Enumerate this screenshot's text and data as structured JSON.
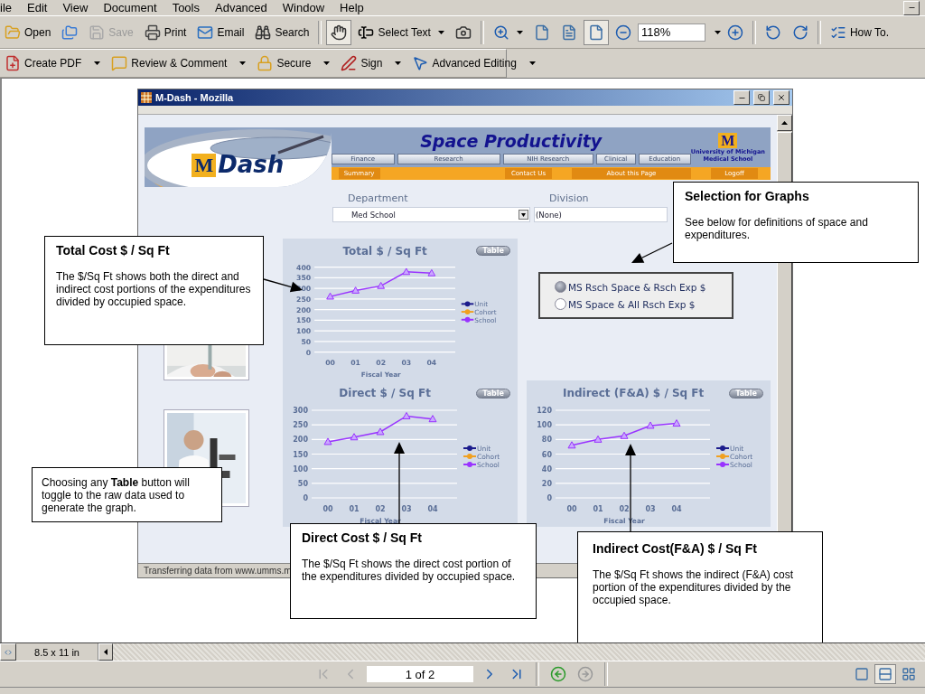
{
  "menu_bar": [
    "ile",
    "Edit",
    "View",
    "Document",
    "Tools",
    "Advanced",
    "Window",
    "Help"
  ],
  "toolbar_1": [
    {
      "kind": "button",
      "label": "Open",
      "selected": false,
      "disabled": false,
      "menu": false
    },
    {
      "kind": "button",
      "selected": false,
      "disabled": false,
      "menu": false
    },
    {
      "kind": "button",
      "label": "Save",
      "selected": false,
      "disabled": true,
      "menu": false
    },
    {
      "kind": "button",
      "label": "Print",
      "selected": false,
      "disabled": false,
      "menu": false
    },
    {
      "kind": "button",
      "label": "Email",
      "selected": false,
      "disabled": false,
      "menu": false
    },
    {
      "kind": "button",
      "label": "Search",
      "selected": false,
      "disabled": false,
      "menu": false
    },
    {
      "kind": "separator"
    },
    {
      "kind": "button",
      "selected": true,
      "disabled": false,
      "menu": false
    },
    {
      "kind": "button",
      "label": "Select Text",
      "selected": false,
      "disabled": false,
      "menu": true
    },
    {
      "kind": "button",
      "selected": false,
      "disabled": false,
      "menu": false
    },
    {
      "kind": "separator"
    },
    {
      "kind": "button",
      "selected": false,
      "disabled": false,
      "menu": true
    },
    {
      "kind": "button",
      "selected": false,
      "disabled": false,
      "menu": false
    },
    {
      "kind": "button",
      "selected": false,
      "disabled": false,
      "menu": false
    },
    {
      "kind": "button",
      "selected": true,
      "disabled": false,
      "menu": false
    },
    {
      "kind": "button",
      "selected": false,
      "disabled": false,
      "menu": false
    },
    {
      "kind": "field",
      "value": "118%"
    },
    {
      "kind": "button",
      "selected": false,
      "disabled": false,
      "menu": false
    },
    {
      "kind": "separator"
    },
    {
      "kind": "button",
      "selected": false,
      "disabled": false,
      "menu": false
    },
    {
      "kind": "button",
      "selected": false,
      "disabled": false,
      "menu": false
    },
    {
      "kind": "separator"
    },
    {
      "kind": "button",
      "label": "How To.",
      "selected": false,
      "disabled": false,
      "menu": false
    }
  ],
  "toolbar_2": [
    {
      "label": "Create PDF"
    },
    {
      "label": "Review & Comment"
    },
    {
      "label": "Secure"
    },
    {
      "label": "Sign"
    },
    {
      "label": "Advanced Editing"
    }
  ],
  "browser": {
    "title": "M-Dash - Mozilla",
    "status": "Transferring data from www.umms.m"
  },
  "mdash": {
    "logo_letter": "M",
    "logo_word": "Dash",
    "heading": "Space Productivity",
    "nav": [
      "Finance",
      "Research",
      "NIH Research",
      "Clinical",
      "Education"
    ],
    "institution_mark": "M",
    "institution": [
      "University of Michigan",
      "Medical School"
    ],
    "links_left": [
      "Summary"
    ],
    "links_right": [
      "Contact Us",
      "About this Page",
      "Logoff"
    ],
    "department": {
      "label": "Department",
      "value": "Med School"
    },
    "division": {
      "label": "Division",
      "value": "(None)"
    },
    "radios": [
      {
        "label": "MS Rsch Space & Rsch Exp $",
        "selected": true
      },
      {
        "label": "MS Space & All Rsch Exp $",
        "selected": false
      }
    ],
    "charts": [
      {
        "title": "Total $ / Sq Ft",
        "table_button": "Table",
        "chart_data": {
          "type": "line",
          "grid": true,
          "xlabel": "Fiscal Year",
          "categories": [
            "00",
            "01",
            "02",
            "03",
            "04"
          ],
          "ylim": [
            0,
            400
          ],
          "yticks": [
            0,
            50,
            100,
            150,
            200,
            250,
            300,
            350,
            400
          ],
          "series": [
            {
              "name": "Unit",
              "color": "#1c1c8c",
              "values": [
                null,
                null,
                null,
                null,
                null
              ]
            },
            {
              "name": "Cohort",
              "color": "#f0a020",
              "values": [
                null,
                null,
                null,
                null,
                null
              ]
            },
            {
              "name": "School",
              "color": "#9933ff",
              "marker": "triangle",
              "values": [
                262,
                290,
                312,
                378,
                372
              ]
            }
          ]
        }
      },
      {
        "title": "Direct $ / Sq Ft",
        "table_button": "Table",
        "chart_data": {
          "type": "line",
          "grid": true,
          "xlabel": "Fiscal Year",
          "categories": [
            "00",
            "01",
            "02",
            "03",
            "04"
          ],
          "ylim": [
            0,
            300
          ],
          "yticks": [
            0,
            50,
            100,
            150,
            200,
            250,
            300
          ],
          "series": [
            {
              "name": "Unit",
              "color": "#1c1c8c",
              "values": [
                null,
                null,
                null,
                null,
                null
              ]
            },
            {
              "name": "Cohort",
              "color": "#f0a020",
              "values": [
                null,
                null,
                null,
                null,
                null
              ]
            },
            {
              "name": "School",
              "color": "#9933ff",
              "marker": "triangle",
              "values": [
                192,
                208,
                226,
                280,
                270
              ]
            }
          ]
        }
      },
      {
        "title": "Indirect (F&A) $ / Sq Ft",
        "table_button": "Table",
        "chart_data": {
          "type": "line",
          "grid": true,
          "xlabel": "Fiscal Year",
          "categories": [
            "00",
            "01",
            "02",
            "03",
            "04"
          ],
          "ylim": [
            0,
            120
          ],
          "yticks": [
            0,
            20,
            40,
            60,
            80,
            100,
            120
          ],
          "series": [
            {
              "name": "Unit",
              "color": "#1c1c8c",
              "values": [
                null,
                null,
                null,
                null,
                null
              ]
            },
            {
              "name": "Cohort",
              "color": "#f0a020",
              "values": [
                null,
                null,
                null,
                null,
                null
              ]
            },
            {
              "name": "School",
              "color": "#9933ff",
              "marker": "triangle",
              "values": [
                72,
                80,
                85,
                99,
                102
              ]
            }
          ]
        }
      }
    ]
  },
  "callouts": [
    {
      "title": "Total Cost $ / Sq Ft",
      "text": "The $/Sq Ft shows both the direct and indirect cost portions of the expenditures divided by occupied space."
    },
    {
      "title": "Selection for Graphs",
      "text": "See below for definitions of space and expenditures."
    },
    {
      "text": "Choosing any **Table** button will toggle to the raw data used to generate the graph."
    },
    {
      "title": "Direct Cost $ / Sq Ft",
      "text": "The $/Sq Ft shows the direct cost portion of the expenditures divided by occupied space."
    },
    {
      "title": "Indirect Cost(F&A) $ / Sq Ft",
      "text": "The $/Sq Ft shows the indirect (F&A) cost portion of the expenditures divided by the occupied space."
    }
  ],
  "page_size": "8.5 x 11 in",
  "navigation": {
    "page": "1 of 2",
    "buttons": [
      {
        "disabled": true
      },
      {
        "disabled": true
      },
      {
        "disabled": false
      },
      {
        "disabled": false
      },
      {
        "disabled": false
      },
      {
        "disabled": true
      }
    ],
    "views": [
      {
        "selected": false
      },
      {
        "selected": true
      },
      {
        "selected": false
      }
    ]
  }
}
